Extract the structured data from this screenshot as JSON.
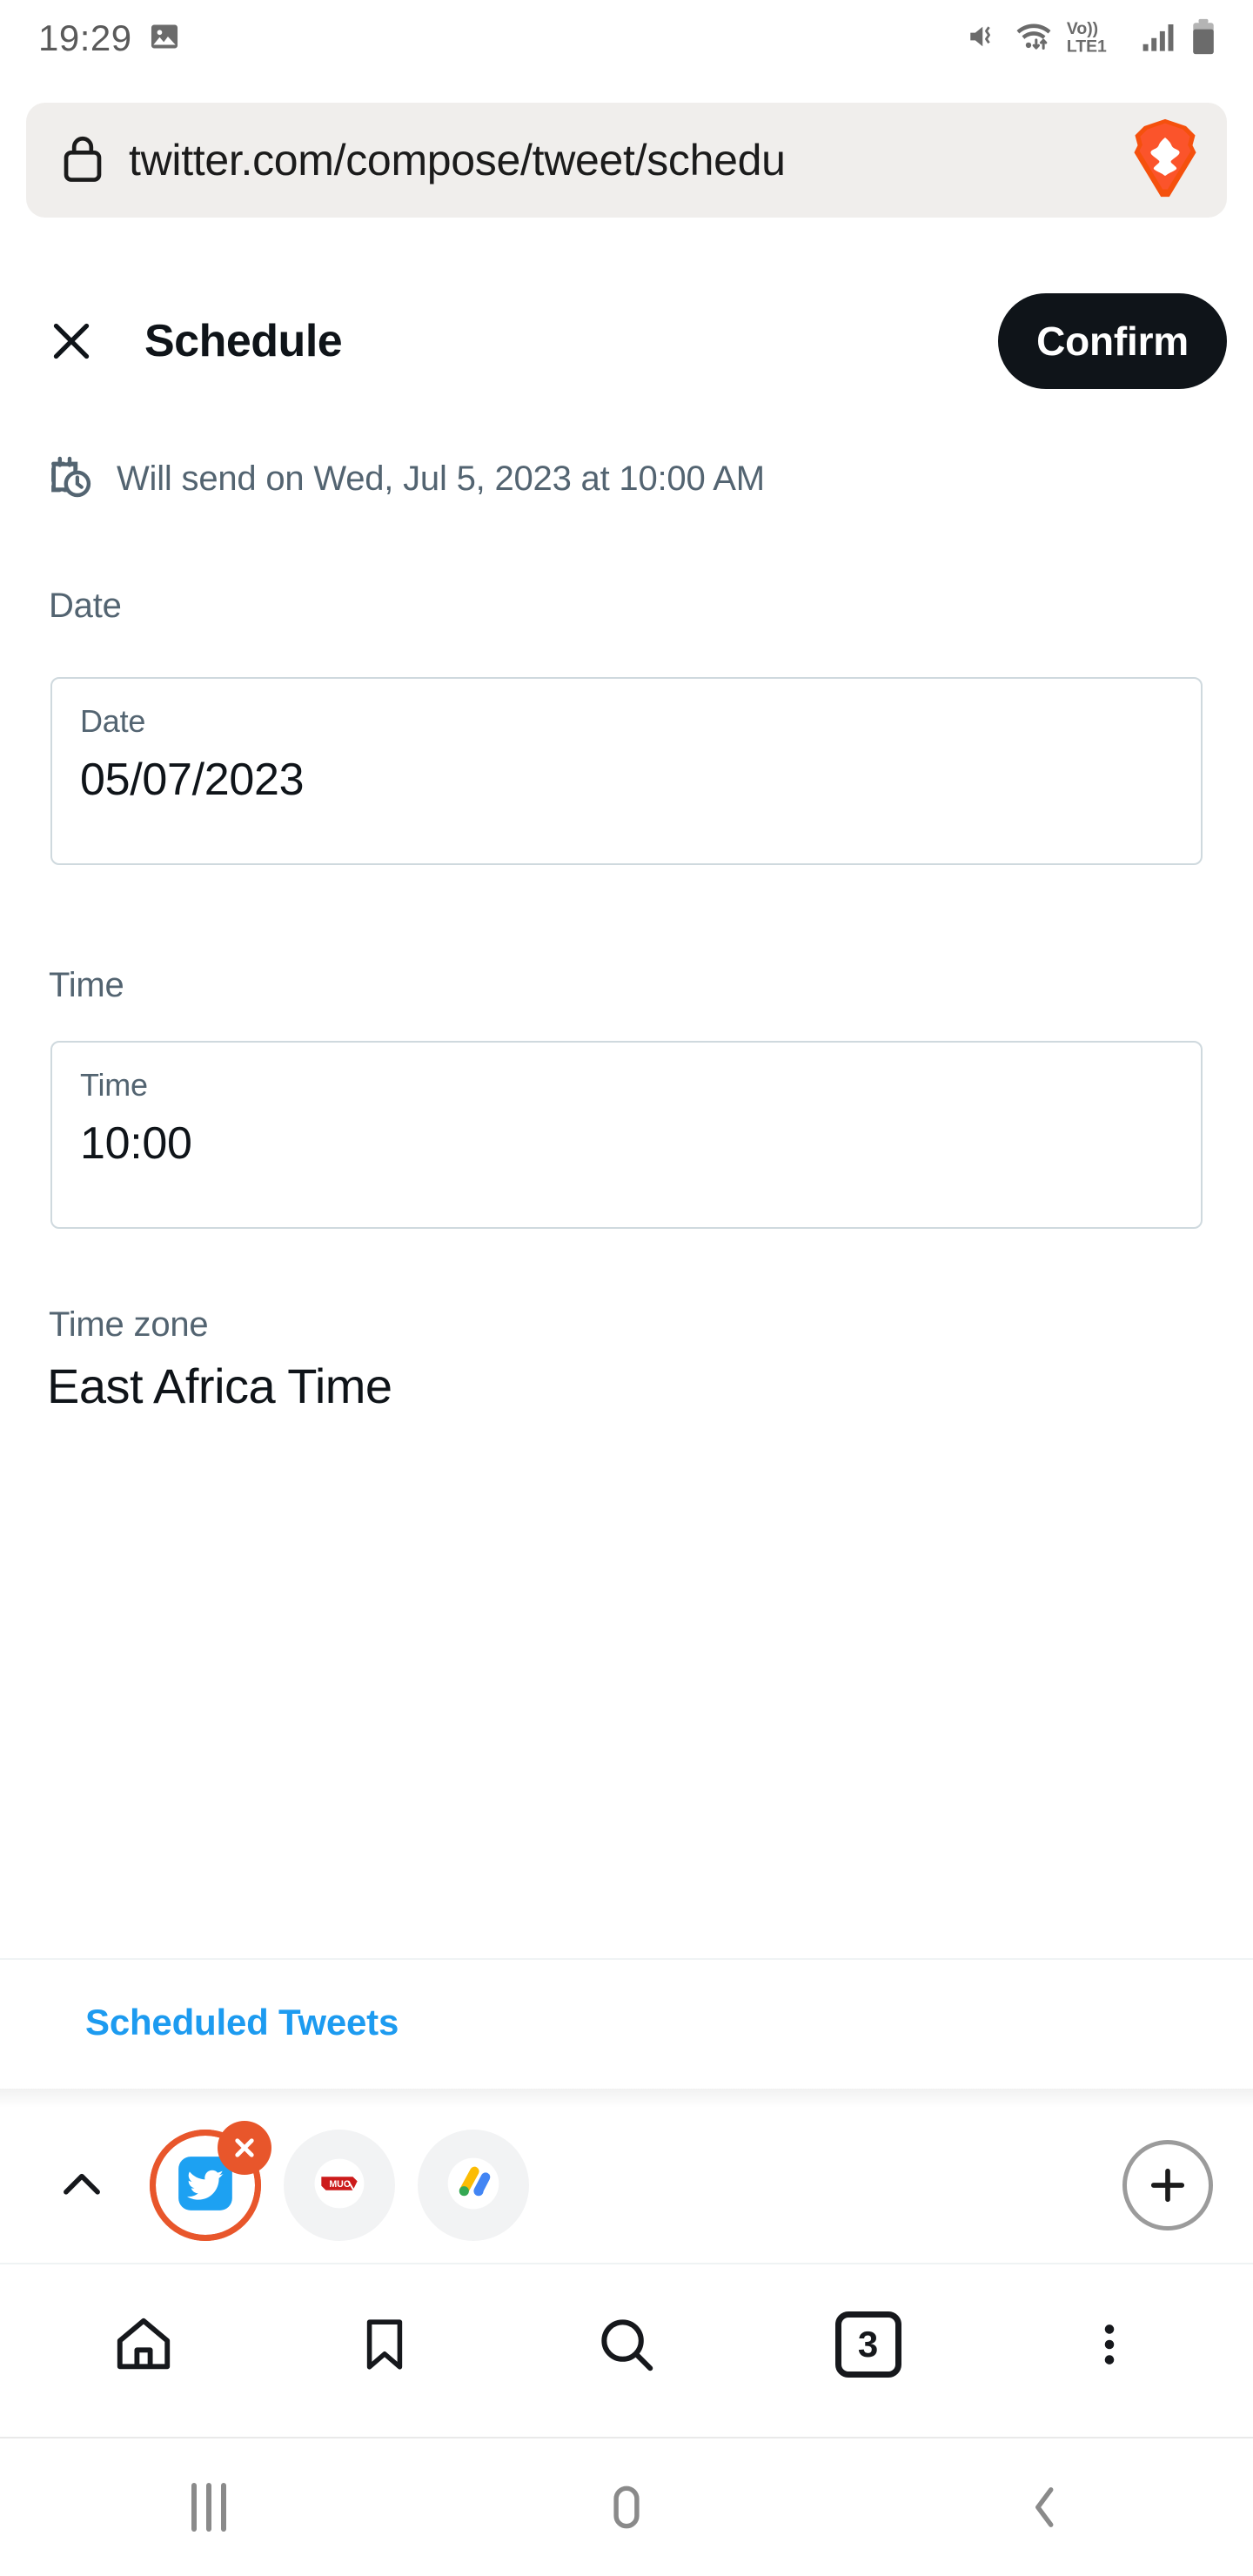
{
  "status_bar": {
    "time": "19:29",
    "left_icons": [
      "image-icon"
    ],
    "right_icons": [
      "mute-vibrate-icon",
      "wifi-icon",
      "volte-icon",
      "signal-bars-icon",
      "battery-icon"
    ],
    "network_label": "Vo))",
    "network_label2": "LTE1"
  },
  "browser": {
    "url": "twitter.com/compose/tweet/schedu",
    "lock_icon": "lock-icon",
    "brave_icon": "brave-lion-icon",
    "tabs": [
      {
        "name": "Twitter",
        "icon": "twitter-bird-icon",
        "active": true,
        "close_label": "×"
      },
      {
        "name": "MakeUseOf",
        "icon": "muo-icon",
        "active": false
      },
      {
        "name": "Google AdSense",
        "icon": "adsense-icon",
        "active": false
      }
    ],
    "new_tab_label": "+",
    "collapse_icon": "chevron-up-icon",
    "toolbar": {
      "home": "home-icon",
      "bookmarks": "bookmark-icon",
      "search": "search-icon",
      "tab_count": "3",
      "menu": "more-vertical-icon"
    }
  },
  "header": {
    "close_label": "×",
    "title": "Schedule",
    "confirm_label": "Confirm"
  },
  "schedule": {
    "will_send_icon": "calendar-clock-icon",
    "will_send_text": "Will send on Wed, Jul 5, 2023 at 10:00 AM",
    "date_section_label": "Date",
    "date_field_label": "Date",
    "date_value": "05/07/2023",
    "time_section_label": "Time",
    "time_field_label": "Time",
    "time_value": "10:00",
    "timezone_label": "Time zone",
    "timezone_value": "East Africa Time",
    "scheduled_tweets_link": "Scheduled Tweets"
  },
  "android_nav": {
    "recents": "recents-icon",
    "home": "home-square-icon",
    "back": "back-chevron-icon"
  },
  "colors": {
    "accent_blue": "#1d9bf0",
    "text_primary": "#0f1419",
    "text_secondary": "#536471",
    "border": "#cfd9de",
    "brave_orange": "#e8562b",
    "confirm_bg": "#0f1419"
  }
}
